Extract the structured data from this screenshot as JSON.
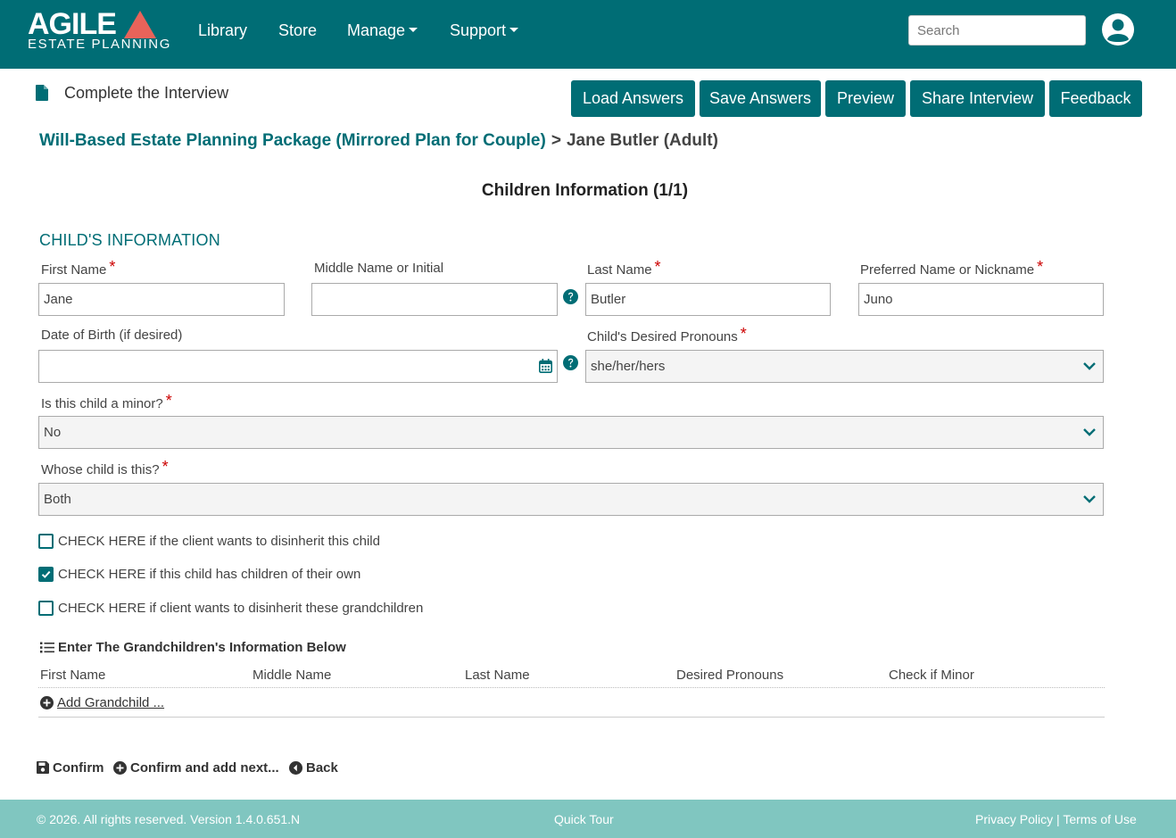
{
  "colors": {
    "brand": "#006d75",
    "footer": "#80c6c0",
    "required": "#cc0000"
  },
  "nav": {
    "logo_top": "AGILE",
    "logo_bottom": "ESTATE PLANNING",
    "items": [
      "Library",
      "Store",
      "Manage",
      "Support"
    ],
    "search_placeholder": "Search",
    "user_icon": "user-circle-icon"
  },
  "header": {
    "page_icon": "file-icon",
    "page_title": "Complete the Interview",
    "buttons": [
      "Load Answers",
      "Save Answers",
      "Preview",
      "Share Interview",
      "Feedback"
    ]
  },
  "breadcrumb": {
    "link": "Will-Based Estate Planning Package (Mirrored Plan for Couple)",
    "separator": ">",
    "current": "Jane Butler (Adult)"
  },
  "section_title": "Children Information (1/1)",
  "group_title": "CHILD'S INFORMATION",
  "fields": {
    "first_name": {
      "label": "First Name",
      "value": "Jane",
      "required": true
    },
    "middle_name": {
      "label": "Middle Name or Initial",
      "value": ""
    },
    "last_name": {
      "label": "Last Name",
      "value": "Butler",
      "required": true
    },
    "preferred_name": {
      "label": "Preferred Name or Nickname",
      "value": "Juno",
      "required": true
    },
    "dob": {
      "label": "Date of Birth (if desired)",
      "value": ""
    },
    "pronouns": {
      "label": "Child's Desired Pronouns",
      "value": "she/her/hers",
      "required": true
    },
    "minor": {
      "label": "Is this child a minor?",
      "value": "No",
      "required": true
    },
    "whose": {
      "label": "Whose child is this?",
      "value": "Both",
      "required": true
    }
  },
  "checkboxes": [
    {
      "label": "CHECK HERE if the client wants to disinherit this child",
      "checked": false
    },
    {
      "label": "CHECK HERE if this child has children of their own",
      "checked": true
    },
    {
      "label": "CHECK HERE if client wants to disinherit these grandchildren",
      "checked": false
    }
  ],
  "grandchildren": {
    "title": "Enter The Grandchildren's Information Below",
    "columns": [
      "First Name",
      "Middle Name",
      "Last Name",
      "Desired Pronouns",
      "Check if Minor"
    ],
    "add_label": "Add Grandchild ..."
  },
  "actions": {
    "confirm": "Confirm",
    "confirm_next": "Confirm and add next...",
    "back": "Back"
  },
  "footer": {
    "copyright": "© 2026. All rights reserved. Version 1.4.0.651.N",
    "quick_tour": "Quick Tour",
    "privacy": "Privacy Policy",
    "sep": "|",
    "terms": "Terms of Use"
  }
}
